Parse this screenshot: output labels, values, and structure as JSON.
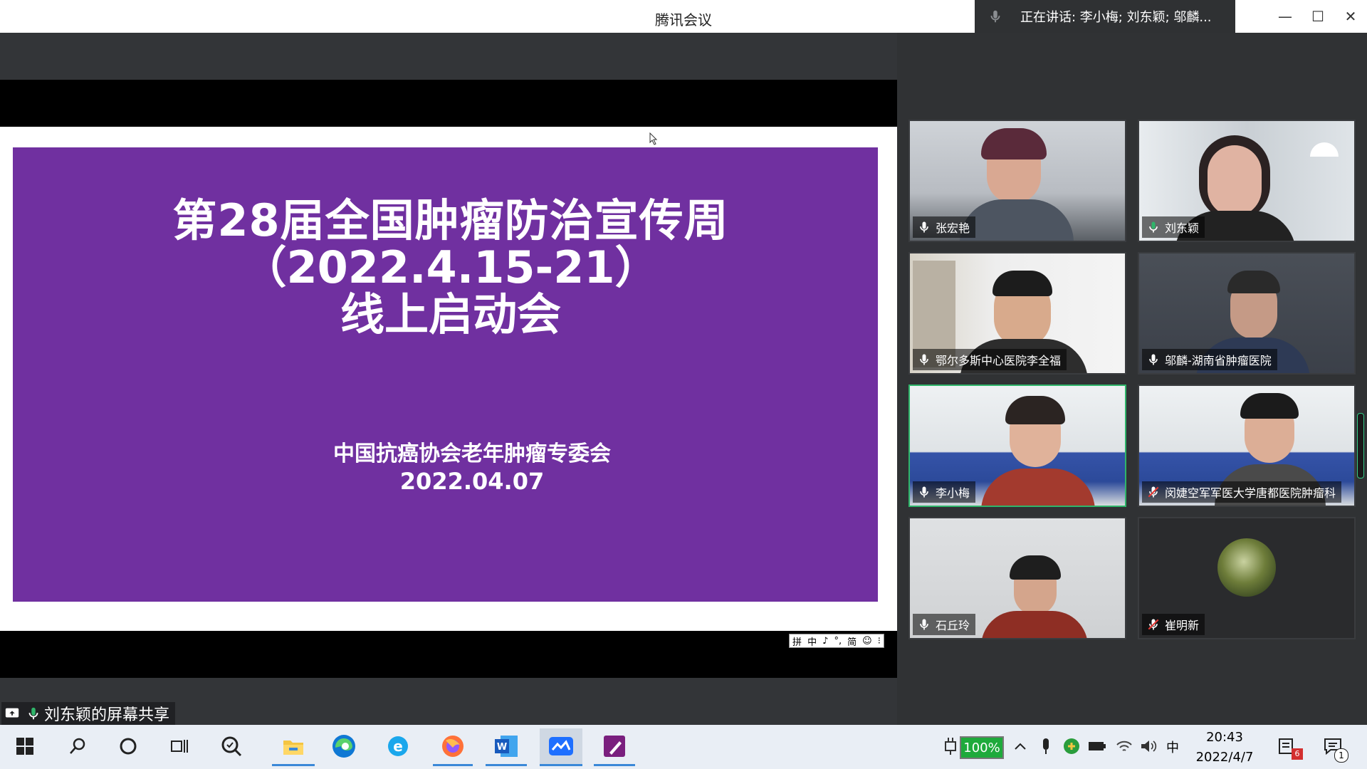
{
  "window": {
    "title": "腾讯会议",
    "speaking_label": "正在讲话: 李小梅; 刘东颖; 邬麟...",
    "minimize": "—",
    "maximize": "☐",
    "close": "✕"
  },
  "slide": {
    "title_line1": "第28届全国肿瘤防治宣传周",
    "title_line2": "（2022.4.15-21）",
    "title_line3": "线上启动会",
    "org": "中国抗癌协会老年肿瘤专委会",
    "date": "2022.04.07",
    "background_color": "#7030a0"
  },
  "ime_bar": [
    "拼",
    "中",
    "♪",
    "°,",
    "简",
    "☺",
    "⁝"
  ],
  "share_label": "刘东颖的屏幕共享",
  "participants": [
    {
      "name": "张宏艳",
      "mic": "on",
      "active": false
    },
    {
      "name": "刘东颖",
      "mic": "speaking",
      "active": false
    },
    {
      "name": "鄂尔多斯中心医院李全福",
      "mic": "on",
      "active": false
    },
    {
      "name": "邬麟-湖南省肿瘤医院",
      "mic": "on",
      "active": false
    },
    {
      "name": "李小梅",
      "mic": "on",
      "active": true
    },
    {
      "name": "闵婕空军军医大学唐都医院肿瘤科",
      "mic": "muted",
      "active": false
    },
    {
      "name": "石丘玲",
      "mic": "on",
      "active": false
    },
    {
      "name": "崔明新",
      "mic": "muted",
      "active": false,
      "avatar_only": true
    }
  ],
  "taskbar": {
    "apps": [
      "start-icon",
      "search-icon",
      "cortana-icon",
      "task-view-icon",
      "magnifier-icon",
      "file-explorer-icon",
      "edge-icon",
      "ie-icon",
      "firefox-icon",
      "word-icon",
      "tencent-meeting-icon",
      "onenote-pen-icon"
    ],
    "battery": "100%",
    "ime": "中",
    "time": "20:43",
    "date": "2022/4/7",
    "notification_count": "6",
    "action_center_count": "1"
  }
}
